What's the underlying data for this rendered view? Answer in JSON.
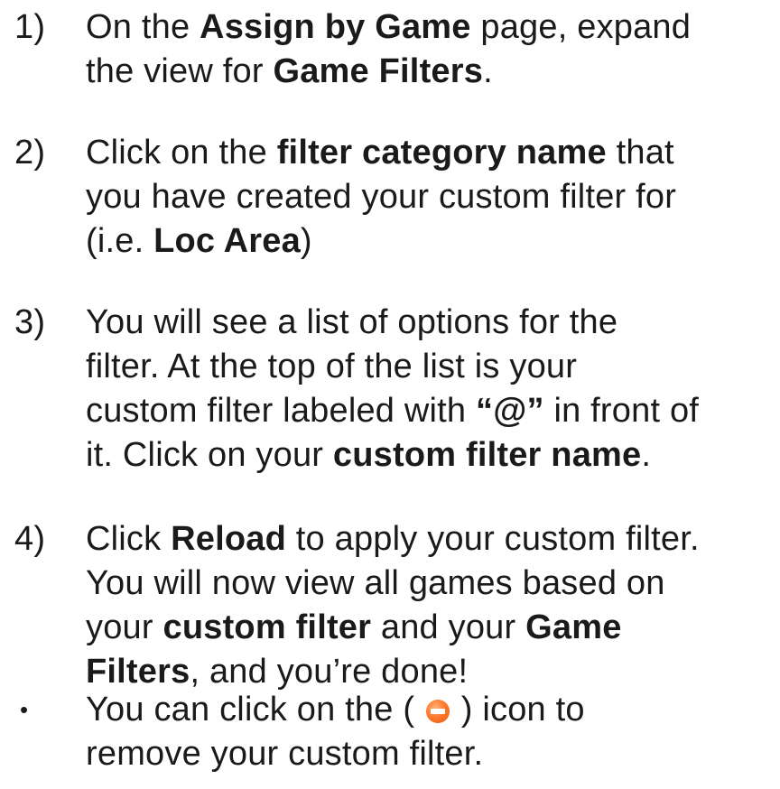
{
  "steps": [
    {
      "number": "1)",
      "lines": [
        [
          "On the ",
          "Assign by Game",
          " page, expand"
        ],
        [
          "the view for ",
          "Game Filters",
          "."
        ]
      ]
    },
    {
      "number": "2)",
      "lines": [
        [
          "Click on the ",
          "filter category name",
          " that"
        ],
        [
          "you have created your custom filter for",
          "",
          ""
        ],
        [
          "(i.e. ",
          "Loc Area",
          ")"
        ]
      ]
    },
    {
      "number": "3)",
      "lines": [
        [
          "You will see a list of options for the",
          "",
          ""
        ],
        [
          "filter. At the top of the list is your",
          "",
          ""
        ],
        [
          "custom filter labeled with ",
          "“@”",
          " in front of"
        ],
        [
          "it. Click on your ",
          "custom filter name",
          "."
        ]
      ]
    },
    {
      "number": "4)",
      "lines": [
        [
          "Click ",
          "Reload",
          " to apply your custom filter."
        ],
        [
          "You will now view all games based on",
          "",
          ""
        ],
        [
          "your ",
          "custom filter",
          " and your "
        ],
        [
          "",
          "Filters",
          ", and you’re done!"
        ]
      ],
      "line3_bold_end": "Game"
    }
  ],
  "bullet": {
    "marker": "•",
    "line1_before_icon": "You can click on the ( ",
    "line1_after_icon": " ) icon to",
    "line2": "remove your custom filter.",
    "icon": "remove-circle-icon",
    "icon_color": "#ff7a2e"
  }
}
